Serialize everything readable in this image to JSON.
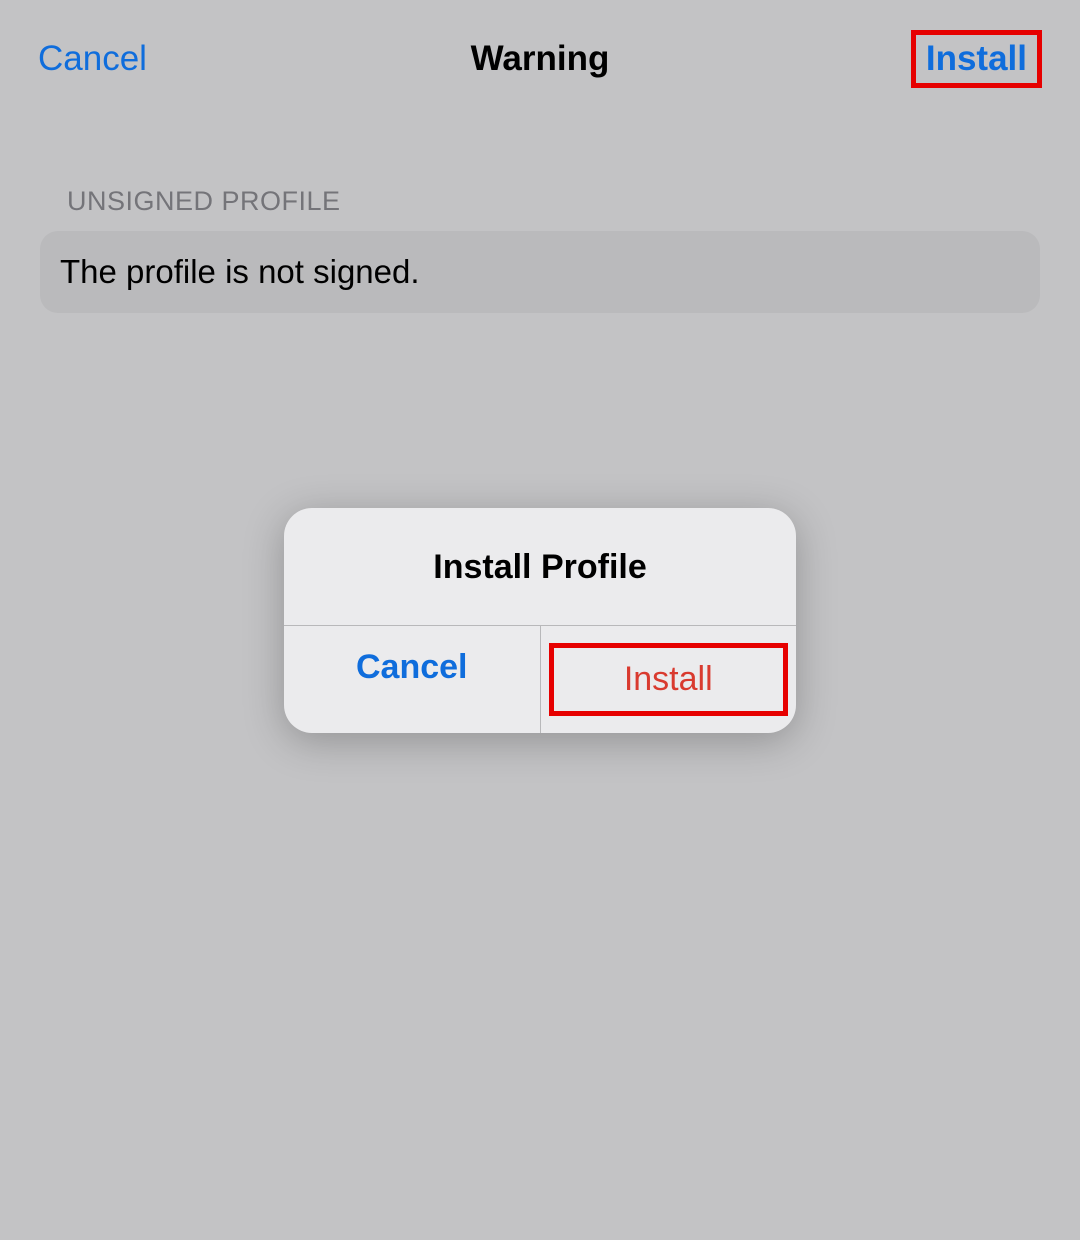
{
  "header": {
    "cancel_label": "Cancel",
    "title": "Warning",
    "install_label": "Install"
  },
  "section": {
    "header": "UNSIGNED PROFILE",
    "message": "The profile is not signed."
  },
  "alert": {
    "title": "Install Profile",
    "cancel_label": "Cancel",
    "install_label": "Install"
  }
}
